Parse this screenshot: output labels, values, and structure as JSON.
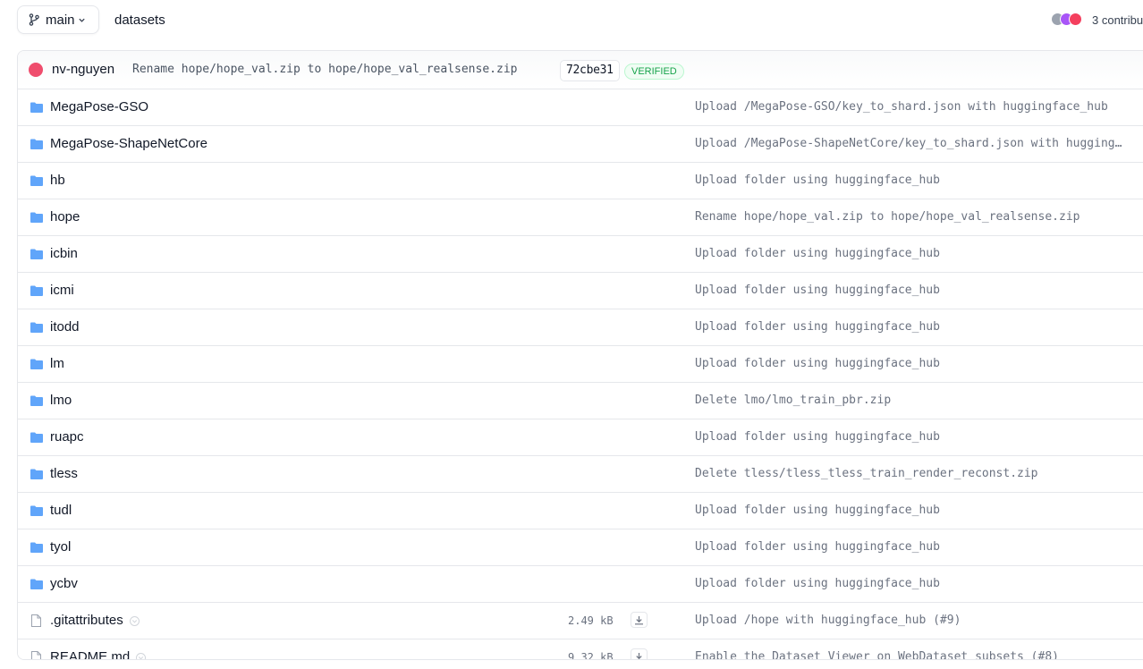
{
  "header": {
    "branch": "main",
    "breadcrumb": "datasets",
    "contributors_text": "3 contribu",
    "avatar_colors": [
      "#9ca3af",
      "#a855f7",
      "#f43f5e"
    ]
  },
  "last_commit": {
    "author": "nv-nguyen",
    "message": "Rename hope/hope_val.zip to hope/hope_val_realsense.zip",
    "hash": "72cbe31",
    "badge": "VERIFIED",
    "avatar_color": "#ef4d6d"
  },
  "entries": [
    {
      "type": "folder",
      "name": "MegaPose-GSO",
      "message": "Upload /MegaPose-GSO/key_to_shard.json with huggingface_hub"
    },
    {
      "type": "folder",
      "name": "MegaPose-ShapeNetCore",
      "message": "Upload /MegaPose-ShapeNetCore/key_to_shard.json with huggingface_hub"
    },
    {
      "type": "folder",
      "name": "hb",
      "message": "Upload folder using huggingface_hub"
    },
    {
      "type": "folder",
      "name": "hope",
      "message": "Rename hope/hope_val.zip to hope/hope_val_realsense.zip"
    },
    {
      "type": "folder",
      "name": "icbin",
      "message": "Upload folder using huggingface_hub"
    },
    {
      "type": "folder",
      "name": "icmi",
      "message": "Upload folder using huggingface_hub"
    },
    {
      "type": "folder",
      "name": "itodd",
      "message": "Upload folder using huggingface_hub"
    },
    {
      "type": "folder",
      "name": "lm",
      "message": "Upload folder using huggingface_hub"
    },
    {
      "type": "folder",
      "name": "lmo",
      "message": "Delete lmo/lmo_train_pbr.zip"
    },
    {
      "type": "folder",
      "name": "ruapc",
      "message": "Upload folder using huggingface_hub"
    },
    {
      "type": "folder",
      "name": "tless",
      "message": "Delete tless/tless_tless_train_render_reconst.zip"
    },
    {
      "type": "folder",
      "name": "tudl",
      "message": "Upload folder using huggingface_hub"
    },
    {
      "type": "folder",
      "name": "tyol",
      "message": "Upload folder using huggingface_hub"
    },
    {
      "type": "folder",
      "name": "ycbv",
      "message": "Upload folder using huggingface_hub"
    },
    {
      "type": "file",
      "name": ".gitattributes",
      "size": "2.49 kB",
      "message": "Upload /hope with huggingface_hub (#9)"
    },
    {
      "type": "file",
      "name": "README.md",
      "size": "9.32 kB",
      "message": "Enable the Dataset Viewer on WebDataset subsets (#8)"
    }
  ]
}
